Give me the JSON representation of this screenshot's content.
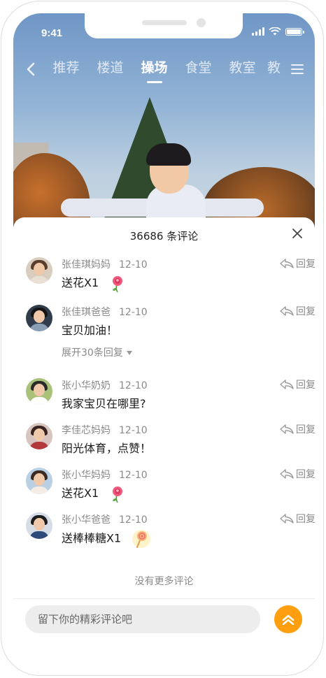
{
  "status_bar": {
    "time": "9:41"
  },
  "nav": {
    "tabs": [
      "推荐",
      "楼道",
      "操场",
      "食堂",
      "教室",
      "教"
    ],
    "active_tab": "操场"
  },
  "comments_panel": {
    "title": "36686 条评论",
    "reply_label": "回复",
    "comments": [
      {
        "name": "张佳琪妈妈",
        "date": "12-10",
        "text": "送花X1",
        "gift": "flower-icon"
      },
      {
        "name": "张佳琪爸爸",
        "date": "12-10",
        "text": "宝贝加油！",
        "expand": "展开30条回复"
      },
      {
        "name": "张小华奶奶",
        "date": "12-10",
        "text": "我家宝贝在哪里?"
      },
      {
        "name": "李佳芯妈妈",
        "date": "12-10",
        "text": "阳光体育，点赞！"
      },
      {
        "name": "张小华妈妈",
        "date": "12-10",
        "text": "送花X1",
        "gift": "flower-icon"
      },
      {
        "name": "张小华爸爸",
        "date": "12-10",
        "text": "送棒棒糖X1",
        "gift": "lollipop-icon"
      }
    ],
    "no_more": "没有更多评论",
    "input_placeholder": "留下你的精彩评论吧"
  },
  "colors": {
    "accent": "#ff9f0f",
    "secondary_text": "#8a8a8a",
    "primary_text": "#1a1a1a"
  }
}
